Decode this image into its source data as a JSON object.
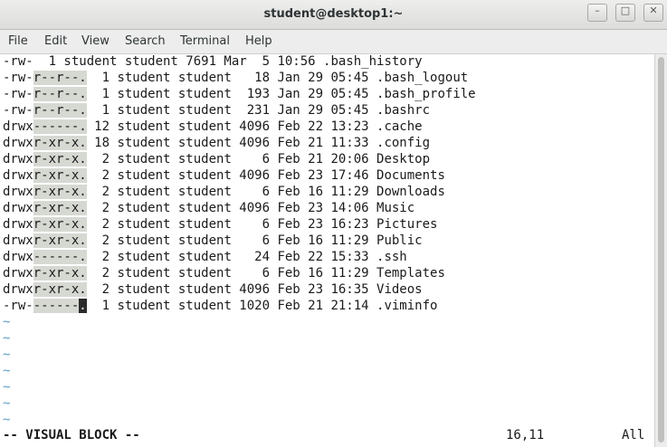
{
  "window": {
    "title": "student@desktop1:~",
    "minimize_glyph": "–",
    "maximize_glyph": "□",
    "close_glyph": "✕"
  },
  "menu": [
    "File",
    "Edit",
    "View",
    "Search",
    "Terminal",
    "Help"
  ],
  "listing": [
    {
      "pre": "-rw-",
      "sel": "",
      "post": "  1 student student 7691 Mar  5 10:56 .bash_history"
    },
    {
      "pre": "-rw-",
      "sel": "r--r--.",
      "post": "  1 student student   18 Jan 29 05:45 .bash_logout"
    },
    {
      "pre": "-rw-",
      "sel": "r--r--.",
      "post": "  1 student student  193 Jan 29 05:45 .bash_profile"
    },
    {
      "pre": "-rw-",
      "sel": "r--r--.",
      "post": "  1 student student  231 Jan 29 05:45 .bashrc"
    },
    {
      "pre": "drwx",
      "sel": "------.",
      "post": " 12 student student 4096 Feb 22 13:23 .cache"
    },
    {
      "pre": "drwx",
      "sel": "r-xr-x.",
      "post": " 18 student student 4096 Feb 21 11:33 .config"
    },
    {
      "pre": "drwx",
      "sel": "r-xr-x.",
      "post": "  2 student student    6 Feb 21 20:06 Desktop"
    },
    {
      "pre": "drwx",
      "sel": "r-xr-x.",
      "post": "  2 student student 4096 Feb 23 17:46 Documents"
    },
    {
      "pre": "drwx",
      "sel": "r-xr-x.",
      "post": "  2 student student    6 Feb 16 11:29 Downloads"
    },
    {
      "pre": "drwx",
      "sel": "r-xr-x.",
      "post": "  2 student student 4096 Feb 23 14:06 Music"
    },
    {
      "pre": "drwx",
      "sel": "r-xr-x.",
      "post": "  2 student student    6 Feb 23 16:23 Pictures"
    },
    {
      "pre": "drwx",
      "sel": "r-xr-x.",
      "post": "  2 student student    6 Feb 16 11:29 Public"
    },
    {
      "pre": "drwx",
      "sel": "------.",
      "post": "  2 student student   24 Feb 22 15:33 .ssh"
    },
    {
      "pre": "drwx",
      "sel": "r-xr-x.",
      "post": "  2 student student    6 Feb 16 11:29 Templates"
    },
    {
      "pre": "drwx",
      "sel": "r-xr-x.",
      "post": "  2 student student 4096 Feb 23 16:35 Videos"
    },
    {
      "pre": "-rw-",
      "sel": "------",
      "cursor": ".",
      "post": "  1 student student 1020 Feb 21 21:14 .viminfo"
    }
  ],
  "tilde_lines": [
    "~",
    "~",
    "~",
    "~",
    "~",
    "~",
    "~"
  ],
  "status": {
    "mode": "-- VISUAL BLOCK --",
    "position": "16,11",
    "scroll": "All"
  },
  "colors": {
    "selection": "#d6d8d2",
    "cursor": "#2b2b2b",
    "tilde": "#5aa0c8"
  }
}
